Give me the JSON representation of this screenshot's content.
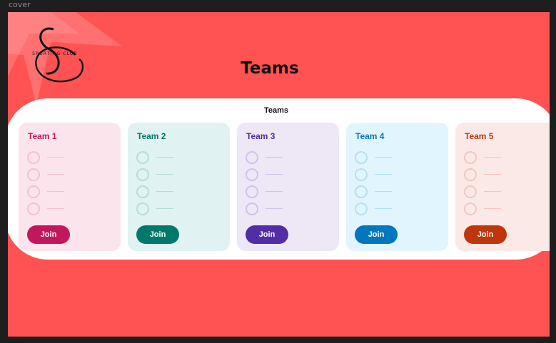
{
  "frame": {
    "label": "cover"
  },
  "logo": {
    "monogram": "SC",
    "tagline": "SPORTING CLUB"
  },
  "page": {
    "title": "Teams"
  },
  "panel": {
    "title": "Teams"
  },
  "colors": {
    "background": "#ff5252",
    "panel": "#ffffff"
  },
  "teams": [
    {
      "name": "Team 1",
      "join_label": "Join",
      "accent": "#c2185b",
      "bg": "#fce4ec",
      "ring": "#f3c1d3",
      "member_slots": 4
    },
    {
      "name": "Team 2",
      "join_label": "Join",
      "accent": "#00796b",
      "bg": "#e0f2f1",
      "ring": "#b5ddd8",
      "member_slots": 4
    },
    {
      "name": "Team 3",
      "join_label": "Join",
      "accent": "#512da8",
      "bg": "#ede7f6",
      "ring": "#cfc3ea",
      "member_slots": 4
    },
    {
      "name": "Team 4",
      "join_label": "Join",
      "accent": "#0277bd",
      "bg": "#e1f5fe",
      "ring": "#b3dff3",
      "member_slots": 4
    },
    {
      "name": "Team 5",
      "join_label": "Join",
      "accent": "#bf360c",
      "bg": "#fbe9e7",
      "ring": "#f3c7bd",
      "member_slots": 4
    }
  ]
}
